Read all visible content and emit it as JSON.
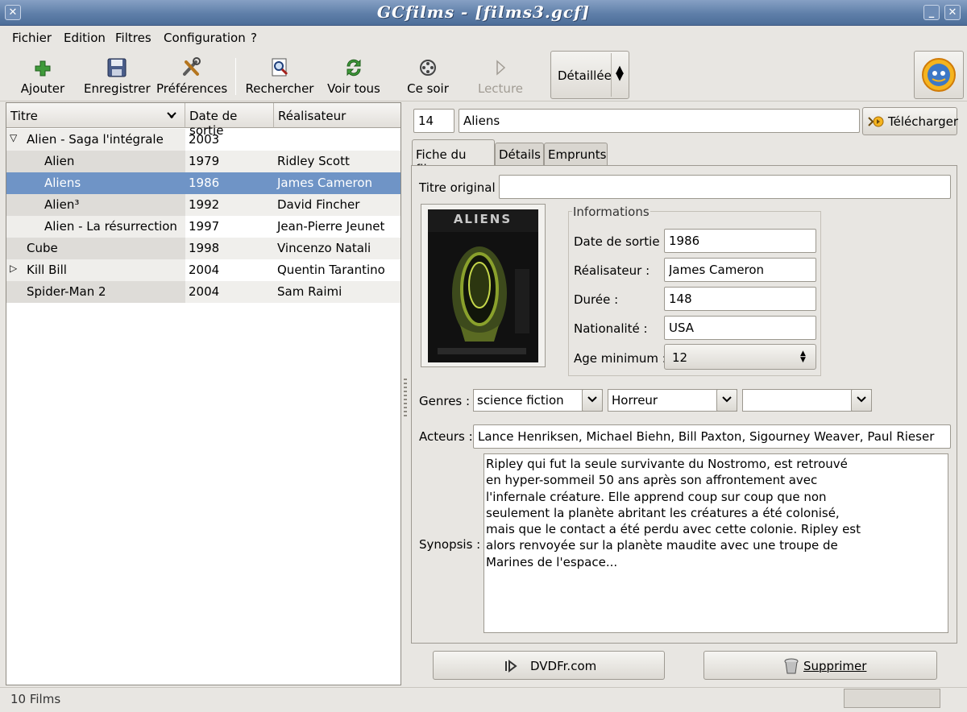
{
  "window": {
    "title": "GCfilms - [films3.gcf]"
  },
  "menubar": [
    {
      "label": "Fichier"
    },
    {
      "label": "Edition"
    },
    {
      "label": "Filtres"
    },
    {
      "label": "Configuration"
    },
    {
      "label": "?"
    }
  ],
  "toolbar": {
    "add": "Ajouter",
    "save": "Enregistrer",
    "prefs": "Préférences",
    "search": "Rechercher",
    "show_all": "Voir tous",
    "tonight": "Ce soir",
    "play": "Lecture",
    "view_mode": "Détaillée"
  },
  "list": {
    "columns": [
      "Titre",
      "Date de sortie",
      "Réalisateur"
    ],
    "rows": [
      {
        "title": "Alien - Saga l'intégrale",
        "date": "2003",
        "director": ""
      },
      {
        "title": "Alien",
        "date": "1979",
        "director": "Ridley Scott"
      },
      {
        "title": "Aliens",
        "date": "1986",
        "director": "James Cameron"
      },
      {
        "title": "Alien³",
        "date": "1992",
        "director": "David Fincher"
      },
      {
        "title": "Alien - La résurrection",
        "date": "1997",
        "director": "Jean-Pierre Jeunet"
      },
      {
        "title": "Cube",
        "date": "1998",
        "director": "Vincenzo Natali"
      },
      {
        "title": "Kill Bill",
        "date": "2004",
        "director": "Quentin Tarantino"
      },
      {
        "title": "Spider-Man 2",
        "date": "2004",
        "director": "Sam Raimi"
      }
    ]
  },
  "detail": {
    "id": "14",
    "title": "Aliens",
    "download_label": "Télécharger",
    "tabs": [
      "Fiche du film",
      "Détails",
      "Emprunts"
    ],
    "original_title_label": "Titre original :",
    "original_title": "",
    "poster_text": "ALIENS",
    "info_frame_title": "Informations",
    "date_label": "Date de sortie :",
    "date": "1986",
    "director_label": "Réalisateur :",
    "director": "James Cameron",
    "duration_label": "Durée :",
    "duration": "148",
    "nationality_label": "Nationalité :",
    "nationality": "USA",
    "age_label": "Age minimum :",
    "age": "12",
    "genres_label": "Genres :",
    "genres": [
      "science fiction",
      "Horreur",
      ""
    ],
    "actors_label": "Acteurs :",
    "actors": "Lance Henriksen, Michael Biehn, Bill Paxton, Sigourney Weaver, Paul Rieser",
    "synopsis_label": "Synopsis :",
    "synopsis": "Ripley qui fut la seule survivante du Nostromo, est retrouvé\nen hyper-sommeil 50 ans après son affrontement avec\nl'infernale créature. Elle apprend coup sur coup que non\nseulement la planète abritant les créatures a été colonisé,\nmais que le contact a été perdu avec cette colonie. Ripley est\nalors renvoyée sur la planète maudite avec une troupe de\nMarines de l'espace...",
    "source_button": "DVDFr.com",
    "delete_button": "Supprimer"
  },
  "status": {
    "count": "10 Films"
  },
  "colors": {
    "selection": "#6f94c6",
    "titlebar": "#5f7fa9"
  }
}
